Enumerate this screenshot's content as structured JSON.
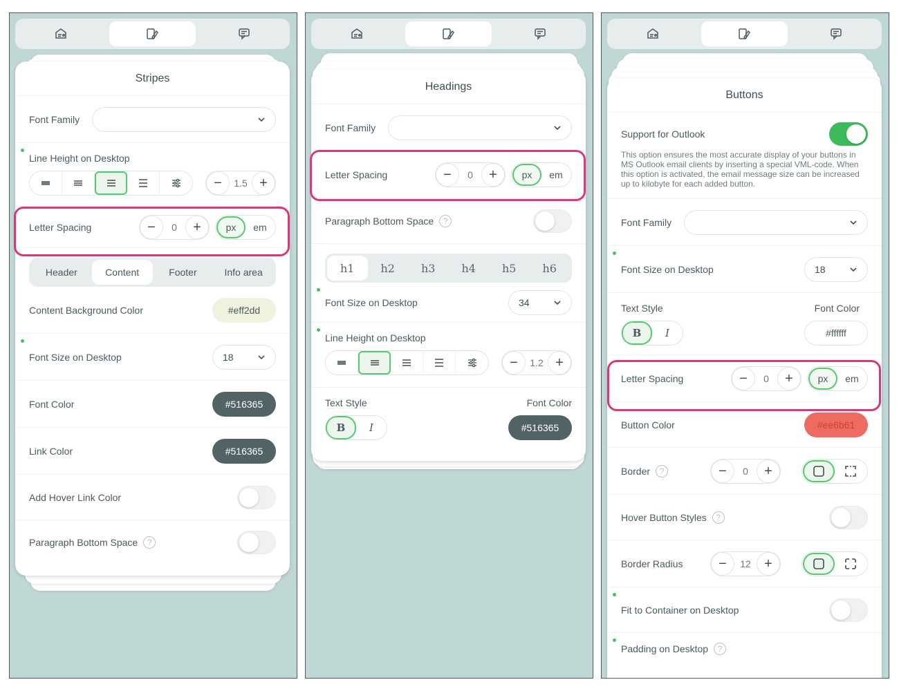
{
  "tabs": [
    {
      "name": "settings-tab",
      "icon": "email-settings-icon"
    },
    {
      "name": "appearance-tab",
      "icon": "brush-paint-icon"
    },
    {
      "name": "comments-tab",
      "icon": "chat-icon"
    }
  ],
  "panel1": {
    "title": "Stripes",
    "font_family_label": "Font Family",
    "font_family_value": "",
    "line_height_label": "Line Height on Desktop",
    "line_height_value": "1.5",
    "letter_spacing_label": "Letter Spacing",
    "letter_spacing_value": "0",
    "unit_px": "px",
    "unit_em": "em",
    "section_tabs": [
      "Header",
      "Content",
      "Footer",
      "Info area"
    ],
    "content_bg_label": "Content Background Color",
    "content_bg_value": "#eff2dd",
    "font_size_label": "Font Size on Desktop",
    "font_size_value": "18",
    "font_color_label": "Font Color",
    "font_color_value": "#516365",
    "link_color_label": "Link Color",
    "link_color_value": "#516365",
    "hover_link_label": "Add Hover Link Color",
    "paragraph_space_label": "Paragraph Bottom Space"
  },
  "panel2": {
    "title": "Headings",
    "font_family_label": "Font Family",
    "font_family_value": "",
    "letter_spacing_label": "Letter Spacing",
    "letter_spacing_value": "0",
    "unit_px": "px",
    "unit_em": "em",
    "paragraph_space_label": "Paragraph Bottom Space",
    "heading_tabs": [
      "h1",
      "h2",
      "h3",
      "h4",
      "h5",
      "h6"
    ],
    "font_size_label": "Font Size on Desktop",
    "font_size_value": "34",
    "line_height_label": "Line Height on Desktop",
    "line_height_value": "1.2",
    "text_style_label": "Text Style",
    "bold_label": "B",
    "italic_label": "I",
    "font_color_label": "Font Color",
    "font_color_value": "#516365"
  },
  "panel3": {
    "title": "Buttons",
    "outlook_label": "Support for Outlook",
    "outlook_note": "This option ensures the most accurate display of your buttons in MS Outlook email clients by inserting a special VML-code. When this option is activated, the email message size can be increased up to kilobyte for each added button.",
    "font_family_label": "Font Family",
    "font_family_value": "",
    "font_size_label": "Font Size on Desktop",
    "font_size_value": "18",
    "text_style_label": "Text Style",
    "bold_label": "B",
    "italic_label": "I",
    "font_color_label": "Font Color",
    "font_color_value": "#ffffff",
    "letter_spacing_label": "Letter Spacing",
    "letter_spacing_value": "0",
    "unit_px": "px",
    "unit_em": "em",
    "button_color_label": "Button Color",
    "button_color_value": "#ee6b61",
    "border_label": "Border",
    "border_value": "0",
    "hover_styles_label": "Hover Button Styles",
    "border_radius_label": "Border Radius",
    "border_radius_value": "12",
    "fit_container_label": "Fit to Container on Desktop",
    "padding_label": "Padding on Desktop"
  },
  "colors": {
    "panel_bg": "#bfd8d6",
    "accent_green": "#56c96f",
    "highlight_pink": "#d83779",
    "dark_swatch": "#516365",
    "light_swatch": "#eff2dd",
    "button_swatch": "#ee6b61"
  }
}
